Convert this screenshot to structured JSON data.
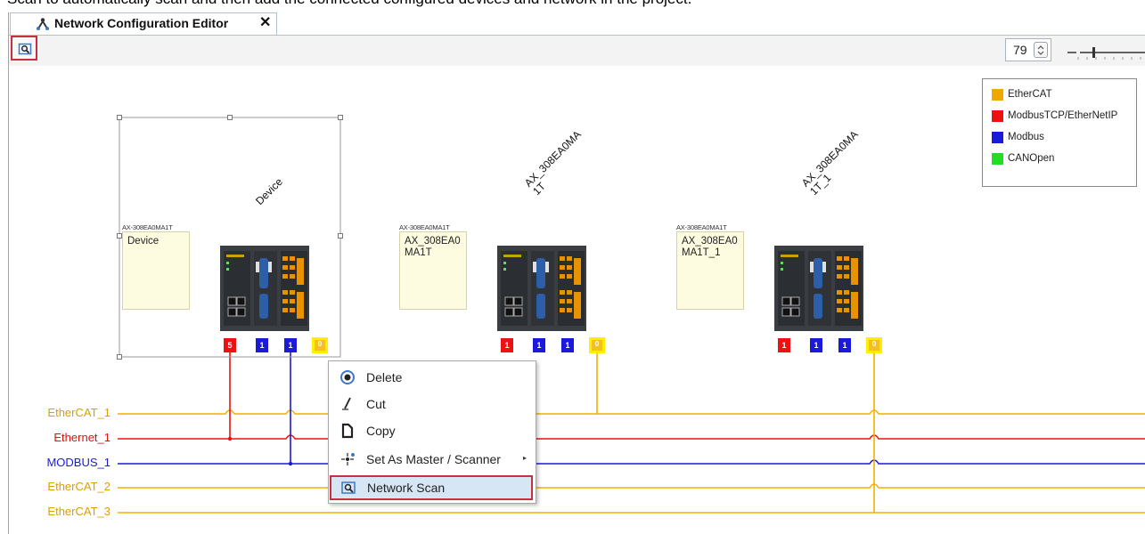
{
  "caption": "Scan to automatically scan and then add the connected configured devices and network in the project.",
  "tab": {
    "title": "Network Configuration Editor",
    "close": "✕",
    "icon": "network-editor-icon"
  },
  "toolbar": {
    "scan_icon": "network-scan-icon",
    "zoom_value": "79"
  },
  "legend": [
    {
      "label": "EtherCAT",
      "color": "#f0a800"
    },
    {
      "label": "ModbusTCP/EtherNetIP",
      "color": "#ee1111"
    },
    {
      "label": "Modbus",
      "color": "#1a1ad8"
    },
    {
      "label": "CANOpen",
      "color": "#22dd22"
    }
  ],
  "buses": [
    {
      "label": "EtherCAT_1",
      "color": "#f0b000",
      "label_color": "#d9a000"
    },
    {
      "label": "Ethernet_1",
      "color": "#ee1111",
      "label_color": "#dd1111"
    },
    {
      "label": "MODBUS_1",
      "color": "#1a1ad8",
      "label_color": "#1a1ad8"
    },
    {
      "label": "EtherCAT_2",
      "color": "#f0b000",
      "label_color": "#d9a000"
    },
    {
      "label": "EtherCAT_3",
      "color": "#f0b000",
      "label_color": "#d9a000"
    }
  ],
  "devices": [
    {
      "name": "Device",
      "model": "AX-308EA0MA1T",
      "note": "Device",
      "ports": [
        "5",
        "1",
        "1",
        "0"
      ],
      "selected": true
    },
    {
      "name": "AX_308EA0MA\n1T",
      "model": "AX-308EA0MA1T",
      "note": "AX_308EA0\nMA1T",
      "ports": [
        "1",
        "1",
        "1",
        "0"
      ],
      "selected": false
    },
    {
      "name": "AX_308EA0MA\n1T_1",
      "model": "AX-308EA0MA1T",
      "note": "AX_308EA0\nMA1T_1",
      "ports": [
        "1",
        "1",
        "1",
        "0"
      ],
      "selected": false
    }
  ],
  "context_menu": {
    "items": [
      {
        "label": "Delete",
        "icon": "delete-icon"
      },
      {
        "label": "Cut",
        "icon": "cut-icon"
      },
      {
        "label": "Copy",
        "icon": "copy-icon"
      },
      {
        "label": "Set As Master / Scanner",
        "icon": "master-scanner-icon",
        "submenu": "▸"
      },
      {
        "label": "Network Scan",
        "icon": "network-scan-icon"
      }
    ]
  }
}
